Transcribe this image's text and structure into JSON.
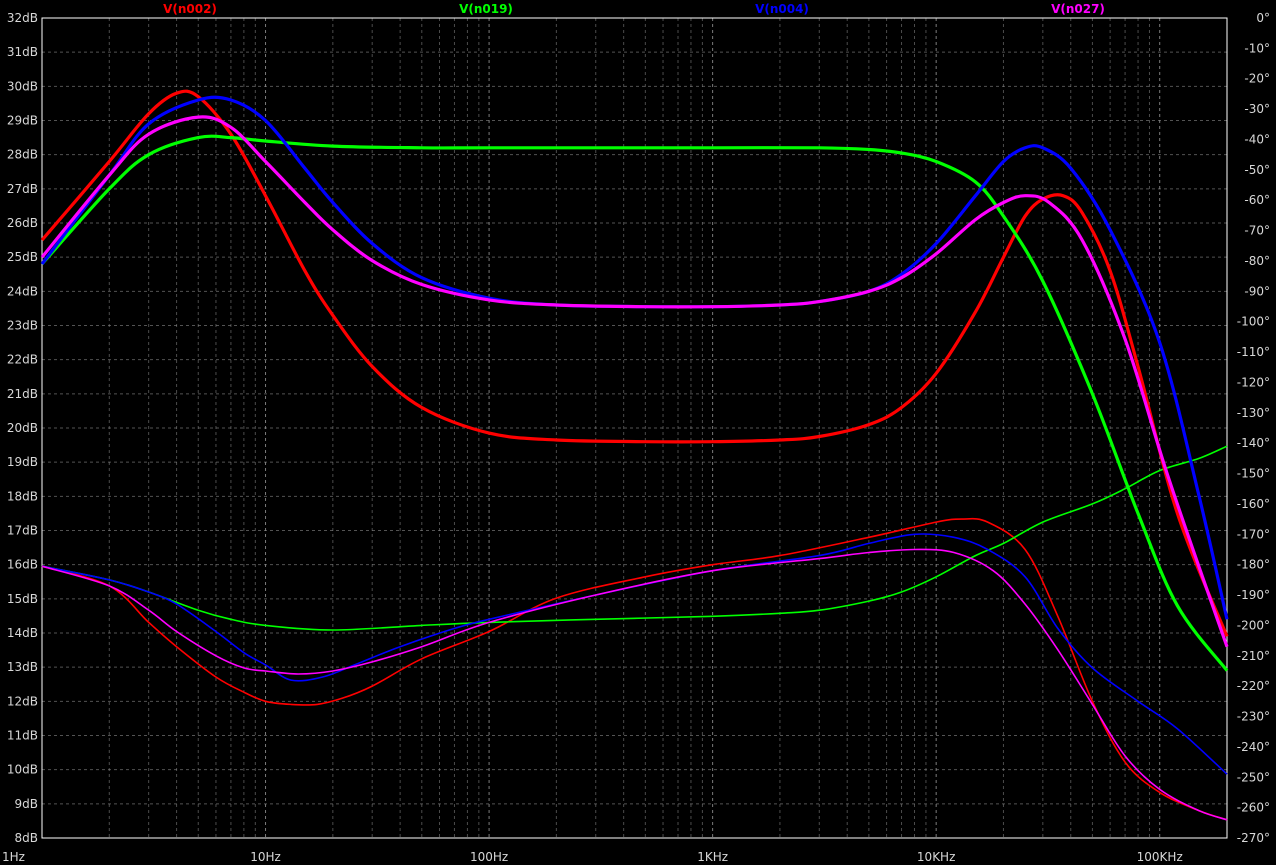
{
  "chart_data": {
    "type": "line",
    "title": "",
    "xlabel": "",
    "ylabel": "",
    "x_scale": "log",
    "xlim": [
      1,
      200000
    ],
    "ylim_left": [
      8,
      32
    ],
    "ylim_right": [
      -270,
      0
    ],
    "grid": true,
    "background": "#000000",
    "x_ticks": [
      1,
      10,
      100,
      1000,
      10000,
      100000
    ],
    "x_tick_labels": [
      "1Hz",
      "10Hz",
      "100Hz",
      "1KHz",
      "10KHz",
      "100KHz"
    ],
    "y_left_ticks": [
      8,
      9,
      10,
      11,
      12,
      13,
      14,
      15,
      16,
      17,
      18,
      19,
      20,
      21,
      22,
      23,
      24,
      25,
      26,
      27,
      28,
      29,
      30,
      31,
      32
    ],
    "y_left_tick_labels": [
      "8dB",
      "9dB",
      "10dB",
      "11dB",
      "12dB",
      "13dB",
      "14dB",
      "15dB",
      "16dB",
      "17dB",
      "18dB",
      "19dB",
      "20dB",
      "21dB",
      "22dB",
      "23dB",
      "24dB",
      "25dB",
      "26dB",
      "27dB",
      "28dB",
      "29dB",
      "30dB",
      "31dB",
      "32dB"
    ],
    "y_right_ticks": [
      0,
      -10,
      -20,
      -30,
      -40,
      -50,
      -60,
      -70,
      -80,
      -90,
      -100,
      -110,
      -120,
      -130,
      -140,
      -150,
      -160,
      -170,
      -180,
      -190,
      -200,
      -210,
      -220,
      -230,
      -240,
      -250,
      -260,
      -270
    ],
    "y_right_tick_labels": [
      "0°",
      "-10°",
      "-20°",
      "-30°",
      "-40°",
      "-50°",
      "-60°",
      "-70°",
      "-80°",
      "-90°",
      "-100°",
      "-110°",
      "-120°",
      "-130°",
      "-140°",
      "-150°",
      "-160°",
      "-170°",
      "-180°",
      "-190°",
      "-200°",
      "-210°",
      "-220°",
      "-230°",
      "-240°",
      "-250°",
      "-260°",
      "-270°"
    ],
    "series": [
      {
        "name": "V(n002)",
        "color": "#ff0000",
        "magnitude_db": [
          [
            1,
            25.5
          ],
          [
            2,
            27.8
          ],
          [
            3,
            29.2
          ],
          [
            4,
            29.8
          ],
          [
            5,
            29.7
          ],
          [
            7,
            28.6
          ],
          [
            10,
            26.8
          ],
          [
            15,
            24.6
          ],
          [
            20,
            23.3
          ],
          [
            30,
            21.8
          ],
          [
            50,
            20.6
          ],
          [
            100,
            19.85
          ],
          [
            200,
            19.65
          ],
          [
            500,
            19.6
          ],
          [
            1000,
            19.6
          ],
          [
            2000,
            19.65
          ],
          [
            3000,
            19.75
          ],
          [
            5000,
            20.1
          ],
          [
            7000,
            20.6
          ],
          [
            10000,
            21.6
          ],
          [
            15000,
            23.4
          ],
          [
            20000,
            25.0
          ],
          [
            25000,
            26.2
          ],
          [
            30000,
            26.7
          ],
          [
            37000,
            26.8
          ],
          [
            45000,
            26.3
          ],
          [
            60000,
            24.6
          ],
          [
            80000,
            21.8
          ],
          [
            120000,
            17.5
          ],
          [
            200000,
            13.9
          ]
        ],
        "phase_deg": [
          [
            1,
            -180.5
          ],
          [
            2,
            -187
          ],
          [
            3,
            -199
          ],
          [
            4,
            -207
          ],
          [
            6,
            -217
          ],
          [
            8,
            -222
          ],
          [
            10,
            -225
          ],
          [
            13,
            -226
          ],
          [
            17,
            -226
          ],
          [
            22,
            -224
          ],
          [
            30,
            -220
          ],
          [
            50,
            -211
          ],
          [
            100,
            -202
          ],
          [
            200,
            -191
          ],
          [
            500,
            -184
          ],
          [
            1000,
            -180
          ],
          [
            2000,
            -177
          ],
          [
            5000,
            -171
          ],
          [
            10000,
            -166
          ],
          [
            13000,
            -165
          ],
          [
            17000,
            -166
          ],
          [
            25000,
            -175
          ],
          [
            35000,
            -197
          ],
          [
            50000,
            -225
          ],
          [
            70000,
            -245
          ],
          [
            100000,
            -255
          ],
          [
            150000,
            -261
          ],
          [
            200000,
            -264
          ]
        ]
      },
      {
        "name": "V(n019)",
        "color": "#00ff00",
        "magnitude_db": [
          [
            1,
            24.8
          ],
          [
            2,
            27.0
          ],
          [
            3,
            28.0
          ],
          [
            5,
            28.5
          ],
          [
            7,
            28.5
          ],
          [
            10,
            28.4
          ],
          [
            20,
            28.25
          ],
          [
            50,
            28.2
          ],
          [
            100,
            28.2
          ],
          [
            500,
            28.2
          ],
          [
            1000,
            28.2
          ],
          [
            3000,
            28.2
          ],
          [
            5000,
            28.15
          ],
          [
            7000,
            28.05
          ],
          [
            10000,
            27.8
          ],
          [
            15000,
            27.2
          ],
          [
            20000,
            26.2
          ],
          [
            30000,
            24.3
          ],
          [
            50000,
            21.0
          ],
          [
            80000,
            17.5
          ],
          [
            120000,
            14.8
          ],
          [
            200000,
            12.9
          ]
        ],
        "phase_deg": [
          [
            1,
            -180.5
          ],
          [
            2,
            -185
          ],
          [
            3,
            -189
          ],
          [
            5,
            -195
          ],
          [
            7,
            -198
          ],
          [
            10,
            -200
          ],
          [
            20,
            -201.5
          ],
          [
            50,
            -200
          ],
          [
            100,
            -199
          ],
          [
            300,
            -198
          ],
          [
            1000,
            -197
          ],
          [
            2000,
            -196
          ],
          [
            3000,
            -195
          ],
          [
            5000,
            -192
          ],
          [
            7000,
            -189
          ],
          [
            10000,
            -184
          ],
          [
            15000,
            -177
          ],
          [
            20000,
            -173
          ],
          [
            30000,
            -166
          ],
          [
            50000,
            -160
          ],
          [
            70000,
            -155
          ],
          [
            100000,
            -149
          ],
          [
            150000,
            -145
          ],
          [
            200000,
            -141
          ]
        ]
      },
      {
        "name": "V(n004)",
        "color": "#0000ff",
        "magnitude_db": [
          [
            1,
            24.8
          ],
          [
            2,
            27.4
          ],
          [
            3,
            28.9
          ],
          [
            5,
            29.6
          ],
          [
            7,
            29.6
          ],
          [
            10,
            29.0
          ],
          [
            15,
            27.6
          ],
          [
            20,
            26.6
          ],
          [
            30,
            25.4
          ],
          [
            50,
            24.4
          ],
          [
            100,
            23.8
          ],
          [
            200,
            23.6
          ],
          [
            500,
            23.55
          ],
          [
            1000,
            23.55
          ],
          [
            2000,
            23.6
          ],
          [
            3000,
            23.7
          ],
          [
            5000,
            24.0
          ],
          [
            7000,
            24.5
          ],
          [
            10000,
            25.4
          ],
          [
            15000,
            26.8
          ],
          [
            20000,
            27.8
          ],
          [
            25000,
            28.2
          ],
          [
            30000,
            28.2
          ],
          [
            40000,
            27.6
          ],
          [
            60000,
            25.8
          ],
          [
            100000,
            22.5
          ],
          [
            150000,
            18.0
          ],
          [
            200000,
            14.4
          ]
        ],
        "phase_deg": [
          [
            1,
            -180.5
          ],
          [
            2,
            -185
          ],
          [
            3,
            -189
          ],
          [
            4,
            -193
          ],
          [
            6,
            -202
          ],
          [
            8,
            -209
          ],
          [
            10,
            -213
          ],
          [
            13,
            -218
          ],
          [
            18,
            -217
          ],
          [
            25,
            -213
          ],
          [
            40,
            -207
          ],
          [
            70,
            -201
          ],
          [
            100,
            -198
          ],
          [
            300,
            -190
          ],
          [
            1000,
            -182
          ],
          [
            3000,
            -177
          ],
          [
            5000,
            -173
          ],
          [
            8000,
            -170
          ],
          [
            12000,
            -171
          ],
          [
            17000,
            -175
          ],
          [
            25000,
            -184
          ],
          [
            35000,
            -201
          ],
          [
            50000,
            -214
          ],
          [
            80000,
            -225
          ],
          [
            120000,
            -234
          ],
          [
            200000,
            -249
          ]
        ]
      },
      {
        "name": "V(n027)",
        "color": "#ff00ff",
        "magnitude_db": [
          [
            1,
            25.0
          ],
          [
            2,
            27.4
          ],
          [
            3,
            28.6
          ],
          [
            5,
            29.1
          ],
          [
            7,
            28.8
          ],
          [
            10,
            27.8
          ],
          [
            15,
            26.6
          ],
          [
            20,
            25.8
          ],
          [
            30,
            24.9
          ],
          [
            50,
            24.2
          ],
          [
            100,
            23.75
          ],
          [
            200,
            23.6
          ],
          [
            500,
            23.55
          ],
          [
            1000,
            23.55
          ],
          [
            2000,
            23.6
          ],
          [
            3000,
            23.7
          ],
          [
            5000,
            24.0
          ],
          [
            7000,
            24.4
          ],
          [
            10000,
            25.1
          ],
          [
            15000,
            26.1
          ],
          [
            20000,
            26.6
          ],
          [
            25000,
            26.8
          ],
          [
            32000,
            26.6
          ],
          [
            45000,
            25.5
          ],
          [
            70000,
            22.6
          ],
          [
            110000,
            18.5
          ],
          [
            200000,
            13.6
          ]
        ],
        "phase_deg": [
          [
            1,
            -180.5
          ],
          [
            2,
            -187
          ],
          [
            3,
            -195
          ],
          [
            4,
            -202
          ],
          [
            6,
            -210
          ],
          [
            8,
            -214
          ],
          [
            10,
            -215
          ],
          [
            14,
            -216
          ],
          [
            20,
            -215
          ],
          [
            30,
            -212
          ],
          [
            50,
            -207
          ],
          [
            100,
            -199
          ],
          [
            300,
            -190
          ],
          [
            1000,
            -182
          ],
          [
            3000,
            -178
          ],
          [
            5000,
            -176
          ],
          [
            8000,
            -175
          ],
          [
            12000,
            -176
          ],
          [
            18000,
            -182
          ],
          [
            25000,
            -193
          ],
          [
            35000,
            -208
          ],
          [
            50000,
            -226
          ],
          [
            70000,
            -243
          ],
          [
            100000,
            -254
          ],
          [
            150000,
            -261
          ],
          [
            200000,
            -264
          ]
        ]
      }
    ]
  }
}
